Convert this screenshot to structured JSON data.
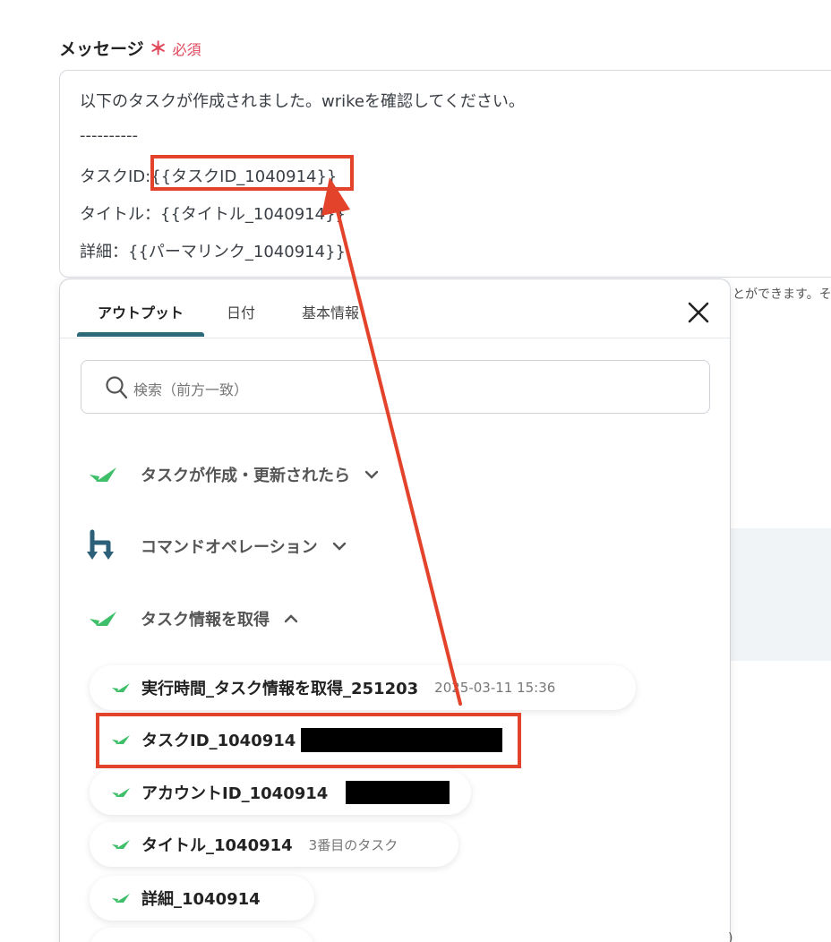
{
  "field": {
    "label": "メッセージ",
    "required_mark": "＊",
    "required_text": "必須"
  },
  "message": {
    "lines": [
      "以下のタスクが作成されました。wrikeを確認してください。",
      "----------",
      "タスクID:{{タスクID_1040914}}",
      "タイトル：{{タイトル_1040914}}",
      "詳細：{{パーマリンク_1040914}}"
    ]
  },
  "side_note": "とができます。そ",
  "edge_mark": ")",
  "popup": {
    "tabs": [
      "アウトプット",
      "日付",
      "基本情報"
    ],
    "active_tab": 0,
    "close_icon": "close-icon",
    "search": {
      "placeholder": "検索（前方一致）",
      "icon": "search-icon"
    },
    "sections": [
      {
        "label": "タスクが作成・更新されたら",
        "icon": "wrike-check-icon",
        "expanded": false
      },
      {
        "label": "コマンドオペレーション",
        "icon": "command-operation-icon",
        "expanded": false
      },
      {
        "label": "タスク情報を取得",
        "icon": "wrike-check-icon",
        "expanded": true
      }
    ],
    "items": [
      {
        "label": "実行時間_タスク情報を取得_251203",
        "value": "2025-03-11 15:36"
      },
      {
        "label": "タスクID_1040914",
        "value": ""
      },
      {
        "label": "アカウントID_1040914",
        "value": ""
      },
      {
        "label": "タイトル_1040914",
        "value": "3番目のタスク"
      },
      {
        "label": "詳細_1040914",
        "value": ""
      }
    ]
  },
  "colors": {
    "required": "#e0455a",
    "accent_tab": "#2c6a7a",
    "wrike_green": "#3fbf6a",
    "command_blue": "#2c5f78",
    "highlight": "#e2432a"
  }
}
